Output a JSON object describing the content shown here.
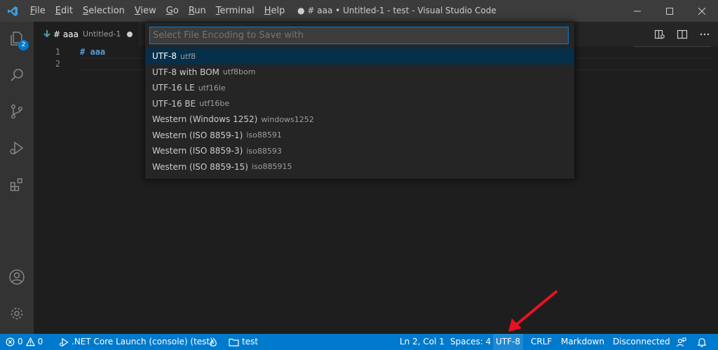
{
  "titlebar": {
    "menu": [
      {
        "pre": "",
        "u": "F",
        "post": "ile"
      },
      {
        "pre": "",
        "u": "E",
        "post": "dit"
      },
      {
        "pre": "",
        "u": "S",
        "post": "election"
      },
      {
        "pre": "",
        "u": "V",
        "post": "iew"
      },
      {
        "pre": "",
        "u": "G",
        "post": "o"
      },
      {
        "pre": "",
        "u": "R",
        "post": "un"
      },
      {
        "pre": "",
        "u": "T",
        "post": "erminal"
      },
      {
        "pre": "",
        "u": "H",
        "post": "elp"
      }
    ],
    "window_title": "● # aaa • Untitled-1 - test - Visual Studio Code"
  },
  "activitybar": {
    "explorer_badge": "2"
  },
  "tab": {
    "title": "# aaa",
    "description": "Untitled-1"
  },
  "editor": {
    "lines": [
      {
        "number": "1",
        "text": "# aaa"
      },
      {
        "number": "2",
        "text": ""
      }
    ]
  },
  "quickpick": {
    "placeholder": "Select File Encoding to Save with",
    "items": [
      {
        "label": "UTF-8",
        "description": "utf8"
      },
      {
        "label": "UTF-8 with BOM",
        "description": "utf8bom"
      },
      {
        "label": "UTF-16 LE",
        "description": "utf16le"
      },
      {
        "label": "UTF-16 BE",
        "description": "utf16be"
      },
      {
        "label": "Western (Windows 1252)",
        "description": "windows1252"
      },
      {
        "label": "Western (ISO 8859-1)",
        "description": "iso88591"
      },
      {
        "label": "Western (ISO 8859-3)",
        "description": "iso88593"
      },
      {
        "label": "Western (ISO 8859-15)",
        "description": "iso885915"
      }
    ]
  },
  "statusbar": {
    "errors": "0",
    "warnings": "0",
    "launch": ".NET Core Launch (console) (test)",
    "folder": "test",
    "position": "Ln 2, Col 1",
    "spaces": "Spaces: 4",
    "encoding": "UTF-8",
    "eol": "CRLF",
    "language": "Markdown",
    "connection": "Disconnected"
  },
  "colors": {
    "statusbar": "#007acc",
    "accent": "#007fd4",
    "annotation": "#e81123"
  }
}
